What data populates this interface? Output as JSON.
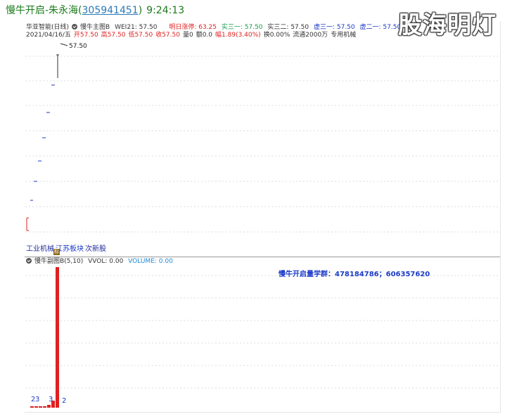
{
  "header": {
    "author_prefix": "慢牛开启-朱永海(",
    "user_id": "305941451",
    "author_suffix": ")",
    "time": "9:24:13"
  },
  "watermark": "股海明灯",
  "main_chart": {
    "stock_name": "华亚智能(日线)",
    "indicator_name": "慢牛主图B",
    "wei21": "WEI21: 57.50",
    "tomorrow_limit": "明日涨停: 63.25",
    "real_1": "实三一: 57.50",
    "real_2": "实三二: 57.50",
    "virtual_1": "虚三一: 57.50",
    "virtual_2": "虚二一: 57.50",
    "virtual_3": "虚三",
    "date": "2021/04/16/五",
    "open": "开57.50",
    "high": "高57.50",
    "low": "低57.50",
    "close": "收57.50",
    "volume": "量0",
    "amount": "额0.0",
    "change": "幅1.89(3.40%)",
    "turnover": "换0.00%",
    "float": "流通2000万",
    "industry": "专用机械",
    "price_label": "57.50",
    "sectors": [
      "工业机械",
      "江苏板块",
      "次新股"
    ]
  },
  "sub_chart": {
    "indicator_name": "慢牛副图B(5,10)",
    "vvol": "VVOL: 0.00",
    "volume": "VOLUME: 0.00",
    "group_text": "慢牛开启量学群：478184786；606357620",
    "labels": [
      "2",
      "3",
      "3",
      "2"
    ]
  },
  "colors": {
    "accent_red": "#e02020",
    "accent_blue": "#1a3ac8",
    "header_green": "#1a7a1a"
  }
}
